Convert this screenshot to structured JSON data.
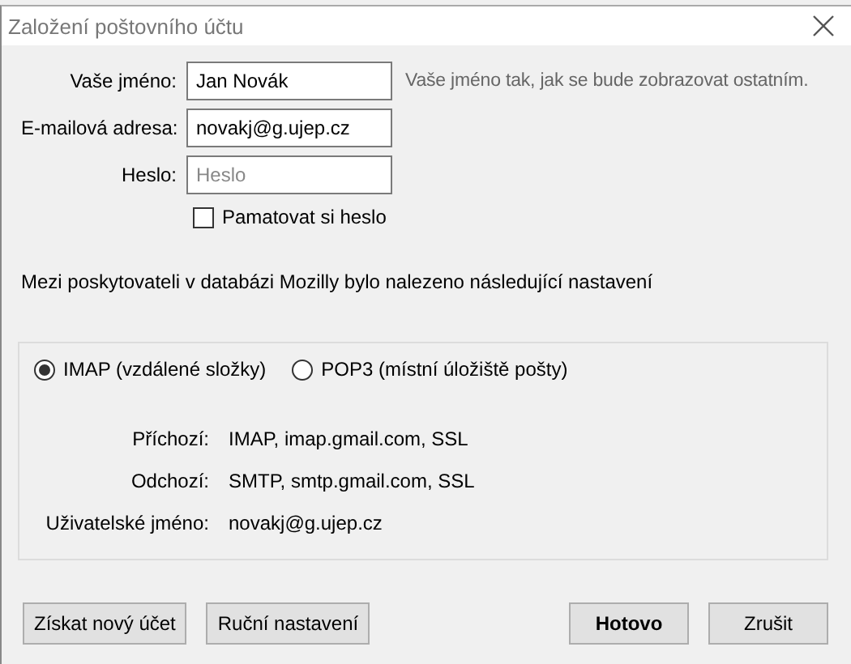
{
  "window": {
    "title": "Založení poštovního účtu"
  },
  "fields": [
    {
      "label": "Vaše jméno:",
      "value": "Jan Novák",
      "hint": "Vaše jméno tak, jak se bude zobrazovat ostatním."
    },
    {
      "label": "E-mailová adresa:",
      "value": "novakj@g.ujep.cz"
    },
    {
      "label": "Heslo:",
      "placeholder": "Heslo"
    }
  ],
  "remember_password": {
    "label": "Pamatovat si heslo",
    "checked": false
  },
  "info": "Mezi poskytovateli v databázi Mozilly bylo nalezeno následující nastavení",
  "protocols": [
    {
      "label": "IMAP (vzdálené složky)",
      "selected": true
    },
    {
      "label": "POP3 (místní úložiště pošty)",
      "selected": false
    }
  ],
  "settings": [
    {
      "label": "Příchozí:",
      "value": "IMAP, imap.gmail.com, SSL"
    },
    {
      "label": "Odchozí:",
      "value": "SMTP, smtp.gmail.com, SSL"
    },
    {
      "label": "Uživatelské jméno:",
      "value": "novakj@g.ujep.cz"
    }
  ],
  "buttons_left": [
    "Získat nový účet",
    "Ruční nastavení"
  ],
  "buttons_right": [
    {
      "label": "Hotovo",
      "default": true
    },
    {
      "label": "Zrušit",
      "default": false
    }
  ]
}
